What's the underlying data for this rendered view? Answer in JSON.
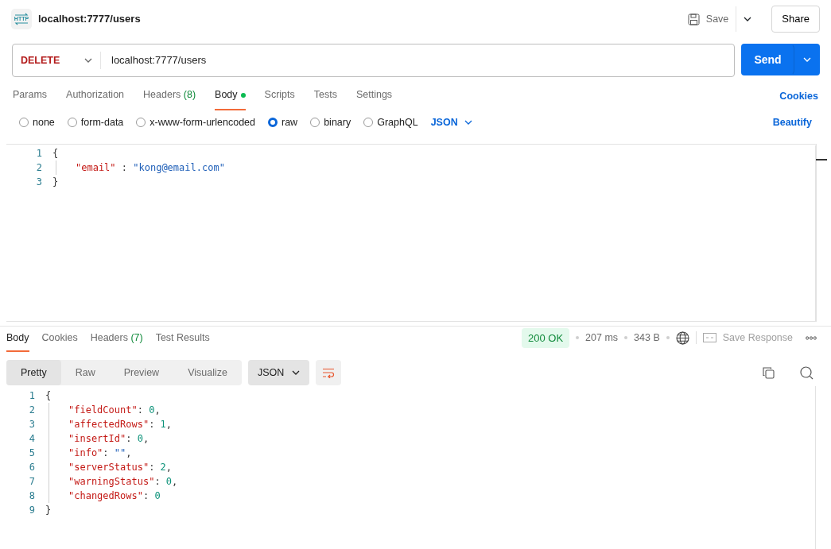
{
  "app_icon_label": "HTTP",
  "tab_title": "localhost:7777/users",
  "toolbar": {
    "save": "Save",
    "share": "Share"
  },
  "request": {
    "method": "DELETE",
    "url": "localhost:7777/users",
    "send": "Send"
  },
  "request_tabs": [
    {
      "label": "Params",
      "selected": false
    },
    {
      "label": "Authorization",
      "selected": false
    },
    {
      "label": "Headers",
      "count": "(8)",
      "selected": false
    },
    {
      "label": "Body",
      "selected": true,
      "dot": true
    },
    {
      "label": "Scripts",
      "selected": false
    },
    {
      "label": "Tests",
      "selected": false
    },
    {
      "label": "Settings",
      "selected": false
    }
  ],
  "cookies_link": "Cookies",
  "body_modes": [
    {
      "label": "none",
      "selected": false
    },
    {
      "label": "form-data",
      "selected": false
    },
    {
      "label": "x-www-form-urlencoded",
      "selected": false
    },
    {
      "label": "raw",
      "selected": true
    },
    {
      "label": "binary",
      "selected": false
    },
    {
      "label": "GraphQL",
      "selected": false
    }
  ],
  "body_format": "JSON",
  "beautify": "Beautify",
  "request_body": [
    {
      "n": "1",
      "indented": false,
      "tokens": [
        {
          "kind": "punct",
          "text": "{"
        }
      ]
    },
    {
      "n": "2",
      "indented": true,
      "tokens": [
        {
          "kind": "key",
          "text": "\"email\""
        },
        {
          "kind": "punct",
          "text": " : "
        },
        {
          "kind": "str",
          "text": "\"kong@email.com\""
        }
      ]
    },
    {
      "n": "3",
      "indented": false,
      "tokens": [
        {
          "kind": "punct",
          "text": "}"
        }
      ]
    }
  ],
  "response_tabs": [
    {
      "label": "Body",
      "selected": true
    },
    {
      "label": "Cookies",
      "selected": false
    },
    {
      "label": "Headers",
      "count": "(7)",
      "selected": false
    },
    {
      "label": "Test Results",
      "selected": false
    }
  ],
  "response_meta": {
    "status": "200 OK",
    "time": "207 ms",
    "size": "343 B",
    "save_response": "Save Response"
  },
  "view_modes": [
    {
      "label": "Pretty",
      "selected": true
    },
    {
      "label": "Raw",
      "selected": false
    },
    {
      "label": "Preview",
      "selected": false
    },
    {
      "label": "Visualize",
      "selected": false
    }
  ],
  "response_format": "JSON",
  "response_body": [
    {
      "n": "1",
      "indented": false,
      "tokens": [
        {
          "kind": "punct",
          "text": "{"
        }
      ]
    },
    {
      "n": "2",
      "indented": true,
      "tokens": [
        {
          "kind": "key",
          "text": "\"fieldCount\""
        },
        {
          "kind": "punct",
          "text": ": "
        },
        {
          "kind": "num",
          "text": "0"
        },
        {
          "kind": "punct",
          "text": ","
        }
      ]
    },
    {
      "n": "3",
      "indented": true,
      "tokens": [
        {
          "kind": "key",
          "text": "\"affectedRows\""
        },
        {
          "kind": "punct",
          "text": ": "
        },
        {
          "kind": "num",
          "text": "1"
        },
        {
          "kind": "punct",
          "text": ","
        }
      ]
    },
    {
      "n": "4",
      "indented": true,
      "tokens": [
        {
          "kind": "key",
          "text": "\"insertId\""
        },
        {
          "kind": "punct",
          "text": ": "
        },
        {
          "kind": "num",
          "text": "0"
        },
        {
          "kind": "punct",
          "text": ","
        }
      ]
    },
    {
      "n": "5",
      "indented": true,
      "tokens": [
        {
          "kind": "key",
          "text": "\"info\""
        },
        {
          "kind": "punct",
          "text": ": "
        },
        {
          "kind": "str",
          "text": "\"\""
        },
        {
          "kind": "punct",
          "text": ","
        }
      ]
    },
    {
      "n": "6",
      "indented": true,
      "tokens": [
        {
          "kind": "key",
          "text": "\"serverStatus\""
        },
        {
          "kind": "punct",
          "text": ": "
        },
        {
          "kind": "num",
          "text": "2"
        },
        {
          "kind": "punct",
          "text": ","
        }
      ]
    },
    {
      "n": "7",
      "indented": true,
      "tokens": [
        {
          "kind": "key",
          "text": "\"warningStatus\""
        },
        {
          "kind": "punct",
          "text": ": "
        },
        {
          "kind": "num",
          "text": "0"
        },
        {
          "kind": "punct",
          "text": ","
        }
      ]
    },
    {
      "n": "8",
      "indented": true,
      "tokens": [
        {
          "kind": "key",
          "text": "\"changedRows\""
        },
        {
          "kind": "punct",
          "text": ": "
        },
        {
          "kind": "num",
          "text": "0"
        }
      ]
    },
    {
      "n": "9",
      "indented": false,
      "tokens": [
        {
          "kind": "punct",
          "text": "}"
        }
      ]
    }
  ]
}
